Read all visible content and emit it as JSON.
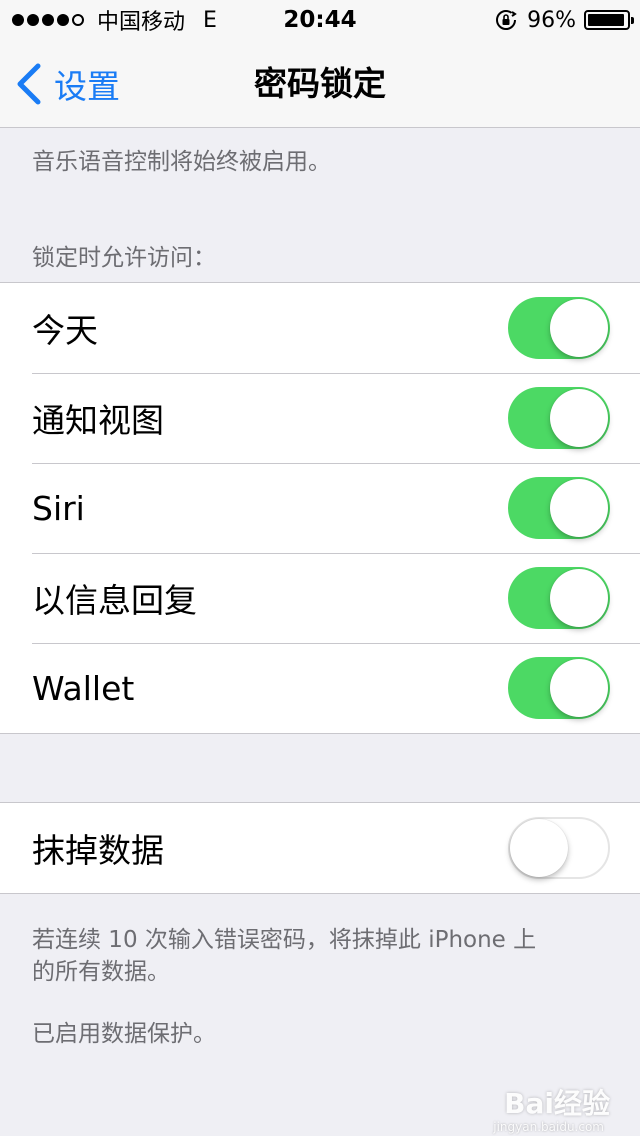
{
  "status_bar": {
    "carrier": "中国移动",
    "network": "E",
    "time": "20:44",
    "battery_percent": "96%",
    "battery_level": 0.96,
    "signal_bars_filled": 4,
    "signal_bars_total": 5
  },
  "nav": {
    "back_label": "设置",
    "title": "密码锁定"
  },
  "top_footnote": "音乐语音控制将始终被启用。",
  "allow_section": {
    "header": "锁定时允许访问：",
    "items": [
      {
        "label": "今天",
        "on": true
      },
      {
        "label": "通知视图",
        "on": true
      },
      {
        "label": "Siri",
        "on": true
      },
      {
        "label": "以信息回复",
        "on": true
      },
      {
        "label": "Wallet",
        "on": true
      }
    ]
  },
  "erase_section": {
    "label": "抹掉数据",
    "on": false,
    "footnote_line1": "若连续 10 次输入错误密码，将抹掉此 iPhone 上",
    "footnote_line2": "的所有数据。",
    "footnote2": "已启用数据保护。"
  },
  "watermark": {
    "text": "Bai经验",
    "sub": "jingyan.baidu.com"
  },
  "colors": {
    "accent": "#1a7cf5",
    "toggle_on": "#4cd964",
    "background": "#efeff4",
    "secondary_text": "#6d6d72"
  }
}
